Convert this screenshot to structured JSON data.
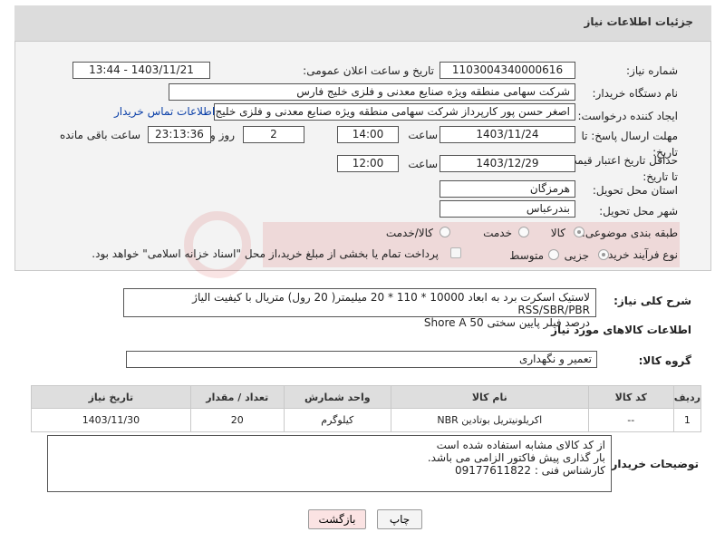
{
  "header": {
    "title": "جزئیات اطلاعات نیاز"
  },
  "fields": {
    "need_number_label": "شماره نیاز:",
    "need_number": "1103004340000616",
    "announce_label": "تاریخ و ساعت اعلان عمومی:",
    "announce_value": "1403/11/21 - 13:44",
    "buyer_org_label": "نام دستگاه خریدار:",
    "buyer_org": "شرکت سهامی منطقه ویژه صنایع معدنی و فلزی خلیج فارس",
    "requester_label": "ایجاد کننده درخواست:",
    "requester": "اصغر حسن پور کارپرداز شرکت سهامی منطقه ویژه صنایع معدنی و فلزی خلیج فارس",
    "contact_link": "اطلاعات تماس خریدار",
    "deadline_label": "مهلت ارسال پاسخ: تا تاریخ:",
    "deadline_date": "1403/11/24",
    "time_label": "ساعت",
    "deadline_time": "14:00",
    "days_value": "2",
    "days_label": "روز و",
    "remaining_value": "23:13:36",
    "remaining_label": "ساعت باقی مانده",
    "validity_label": "حداقل تاریخ اعتبار قیمت: تا تاریخ:",
    "validity_date": "1403/12/29",
    "validity_time": "12:00",
    "province_label": "استان محل تحویل:",
    "province": "هرمزگان",
    "city_label": "شهر محل تحویل:",
    "city": "بندرعباس",
    "category_label": "طبقه بندی موضوعی:",
    "category_options": [
      "کالا",
      "خدمت",
      "کالا/خدمت"
    ],
    "process_label": "نوع فرآیند خرید :",
    "process_options": [
      "جزیی",
      "متوسط"
    ],
    "payment_text": "پرداخت تمام یا بخشی از مبلغ خرید،از محل \"اسناد خزانه اسلامی\" خواهد بود."
  },
  "description": {
    "label": "شرح کلی نیاز:",
    "line1": "لاستیک اسکرت برد به ابعاد  10000  *  110  *  20  میلیمتر( 20 رول) متریال با کیفیت الیاژ RSS/SBR/PBR",
    "line2": "درصد فیلر پایین سختی Shore A 50"
  },
  "goods_info": {
    "title": "اطلاعات کالاهای مورد نیاز"
  },
  "goods_group": {
    "label": "گروه کالا:",
    "value": "تعمیر و نگهداری"
  },
  "table": {
    "headers": [
      "ردیف",
      "کد کالا",
      "نام کالا",
      "واحد شمارش",
      "تعداد / مقدار",
      "تاریخ نیاز"
    ],
    "rows": [
      {
        "row": "1",
        "code": "--",
        "name": "اکریلونیتریل بوتادین NBR",
        "unit": "کیلوگرم",
        "qty": "20",
        "date": "1403/11/30"
      }
    ]
  },
  "buyer_notes": {
    "label": "توضیحات خریدار:",
    "line1": "از کد کالای مشابه استفاده شده است",
    "line2": "بار گذاری پیش فاکتور الزامی می باشد.",
    "line3": "کارشناس فنی : 09177611822"
  },
  "buttons": {
    "print": "چاپ",
    "back": "بازگشت"
  },
  "colors": {
    "header_bg": "#dcdcdc",
    "link": "#0a3fa8",
    "back_button_bg": "#fbe3e3"
  }
}
